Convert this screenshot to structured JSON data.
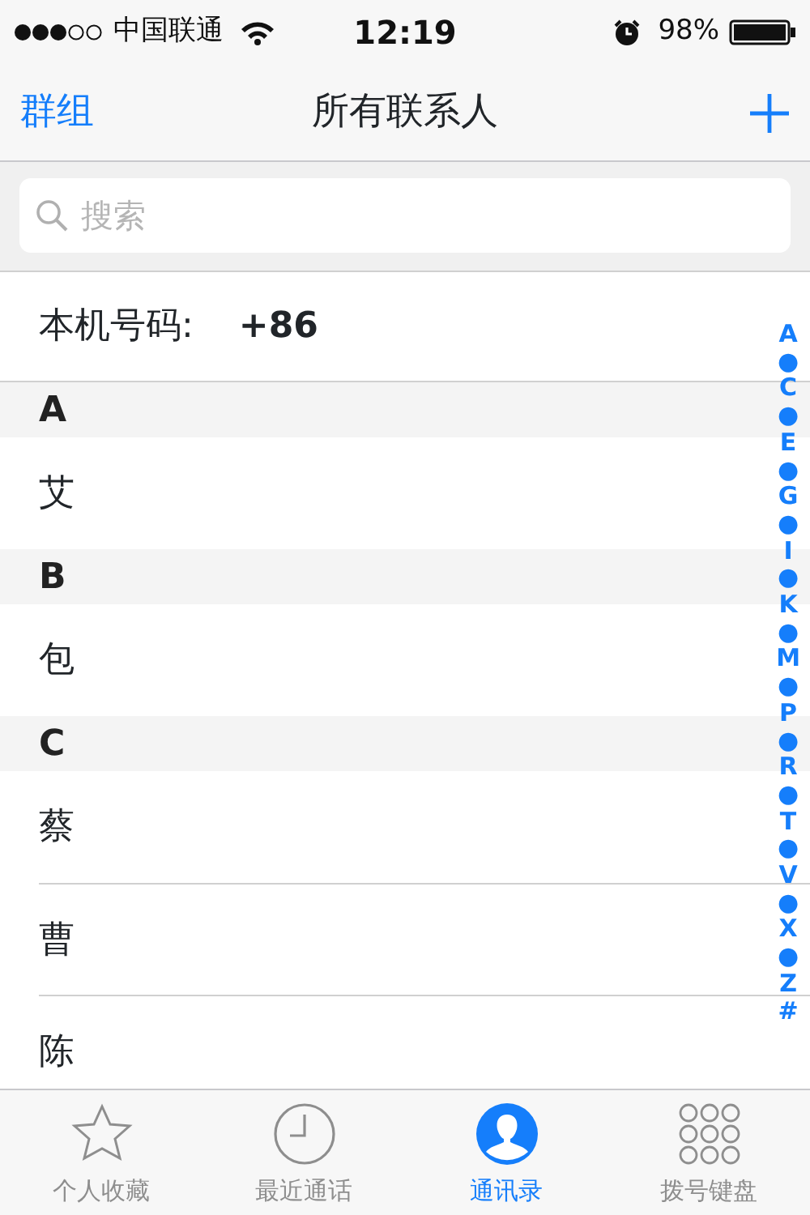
{
  "status_bar": {
    "carrier": "中国联通",
    "time": "12:19",
    "battery": "98%"
  },
  "nav": {
    "left": "群组",
    "title": "所有联系人"
  },
  "search": {
    "placeholder": "搜索"
  },
  "my_number": {
    "label": "本机号码:",
    "value": "+86"
  },
  "sections": [
    {
      "letter": "A",
      "contacts": [
        "艾"
      ]
    },
    {
      "letter": "B",
      "contacts": [
        "包"
      ]
    },
    {
      "letter": "C",
      "contacts": [
        "蔡",
        "曹",
        "陈"
      ]
    }
  ],
  "index": [
    "A",
    "●",
    "C",
    "●",
    "E",
    "●",
    "G",
    "●",
    "I",
    "●",
    "K",
    "●",
    "M",
    "●",
    "P",
    "●",
    "R",
    "●",
    "T",
    "●",
    "V",
    "●",
    "X",
    "●",
    "Z",
    "#"
  ],
  "tabs": [
    {
      "label": "个人收藏",
      "kind": "star",
      "selected": false
    },
    {
      "label": "最近通话",
      "kind": "clock",
      "selected": false
    },
    {
      "label": "通讯录",
      "kind": "person",
      "selected": true
    },
    {
      "label": "拨号键盘",
      "kind": "keypad",
      "selected": false
    }
  ]
}
